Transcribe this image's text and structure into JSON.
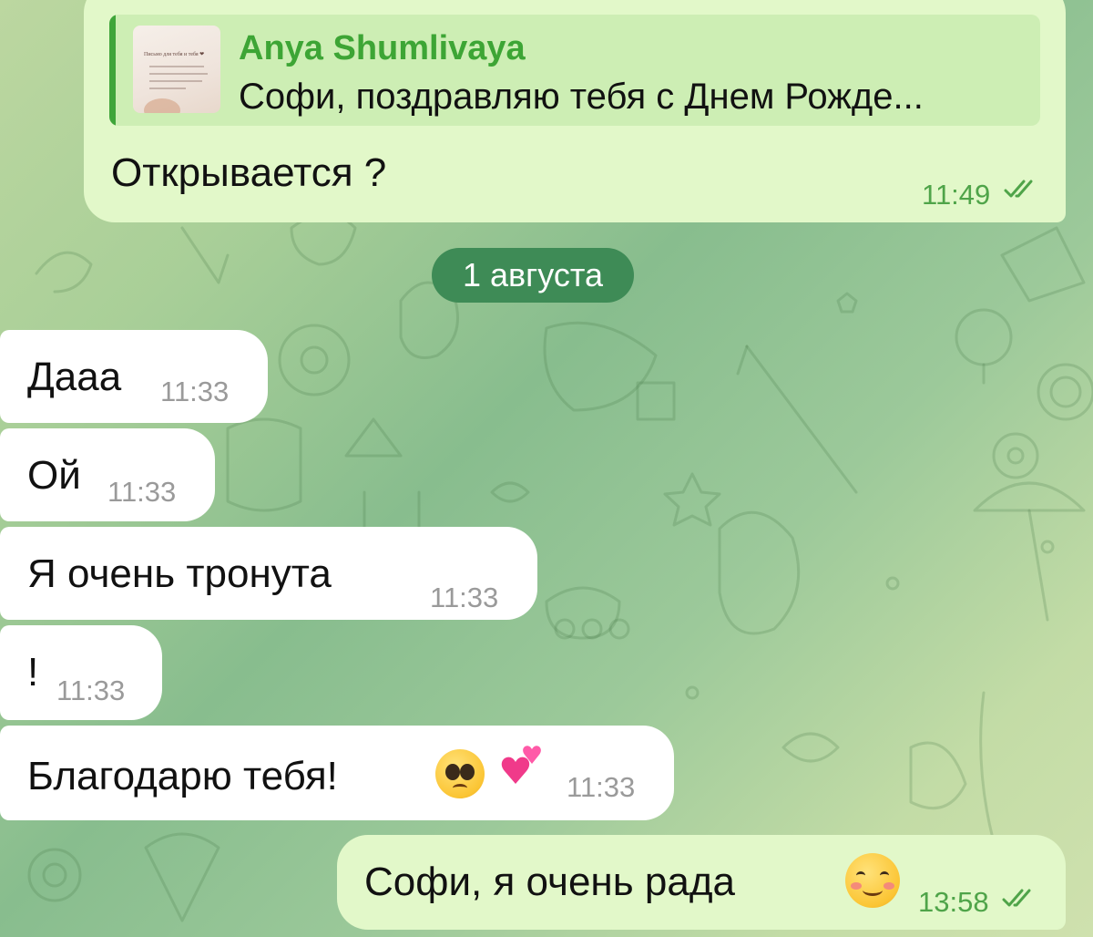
{
  "chat": {
    "reply_message": {
      "quote_author": "Anya Shumlivaya",
      "quote_text": "Софи, поздравляю тебя с Днем Рожде...",
      "quote_thumb_title": "Письмо для тебя и тебя ❤",
      "text": "Открывается ?",
      "time": "11:49"
    },
    "date_separator": "1 августа",
    "incoming": [
      {
        "text": "Дааа",
        "time": "11:33"
      },
      {
        "text": "Ой",
        "time": "11:33"
      },
      {
        "text": "Я очень тронута",
        "time": "11:33"
      },
      {
        "text": "!",
        "time": "11:33"
      },
      {
        "text": "Благодарю тебя!",
        "time": "11:33",
        "emojis": [
          "pleading-face-emoji",
          "two-hearts-emoji"
        ]
      }
    ],
    "outgoing_last": {
      "text": "Софи, я очень рада",
      "time": "13:58",
      "emoji": "smiling-face-with-hearts-emoji"
    },
    "colors": {
      "outgoing_bubble": "#e2f8c9",
      "incoming_bubble": "#ffffff",
      "accent_green": "#3da535",
      "date_pill": "#3e8b56"
    }
  }
}
